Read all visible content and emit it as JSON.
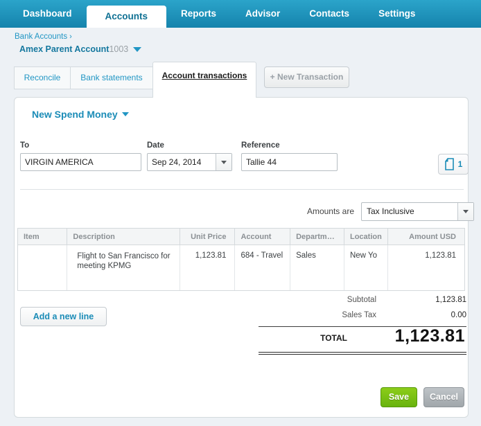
{
  "nav": {
    "items": [
      {
        "label": "Dashboard",
        "active": false
      },
      {
        "label": "Accounts",
        "active": true
      },
      {
        "label": "Reports",
        "active": false
      },
      {
        "label": "Advisor",
        "active": false
      },
      {
        "label": "Contacts",
        "active": false
      },
      {
        "label": "Settings",
        "active": false
      }
    ]
  },
  "breadcrumb": {
    "link": "Bank Accounts",
    "separator": "›",
    "account_name": "Amex Parent Account",
    "account_code": "1003"
  },
  "tabs": {
    "reconcile": "Reconcile",
    "bank_statements": "Bank statements",
    "account_transactions": "Account transactions",
    "new_transaction": "+ New Transaction"
  },
  "panel": {
    "type_selector": "New Spend Money",
    "fields": {
      "to": {
        "label": "To",
        "value": "VIRGIN AMERICA"
      },
      "date": {
        "label": "Date",
        "value": "Sep 24, 2014"
      },
      "reference": {
        "label": "Reference",
        "value": "Tallie 44"
      }
    },
    "attachments": {
      "icon": "file-icon",
      "count": "1"
    },
    "amounts_are": {
      "label": "Amounts are",
      "selected": "Tax Inclusive"
    },
    "table": {
      "columns": [
        "Item",
        "Description",
        "Unit Price",
        "Account",
        "Departm…",
        "Location",
        "Amount USD"
      ],
      "rows": [
        {
          "item": "",
          "description": "Flight to San Francisco for meeting KPMG",
          "unit_price": "1,123.81",
          "account": "684 - Travel",
          "department": "Sales",
          "location": "New Yo",
          "amount": "1,123.81"
        }
      ]
    },
    "totals": {
      "subtotal_label": "Subtotal",
      "subtotal": "1,123.81",
      "sales_tax_label": "Sales Tax",
      "sales_tax": "0.00",
      "total_label": "TOTAL",
      "total": "1,123.81"
    },
    "add_line_label": "Add a new line",
    "save_label": "Save",
    "cancel_label": "Cancel"
  },
  "colors": {
    "nav_teal": "#1b8fb8",
    "link_blue": "#1b8cb7",
    "save_green": "#77bf11",
    "cancel_gray": "#a8adb1"
  }
}
